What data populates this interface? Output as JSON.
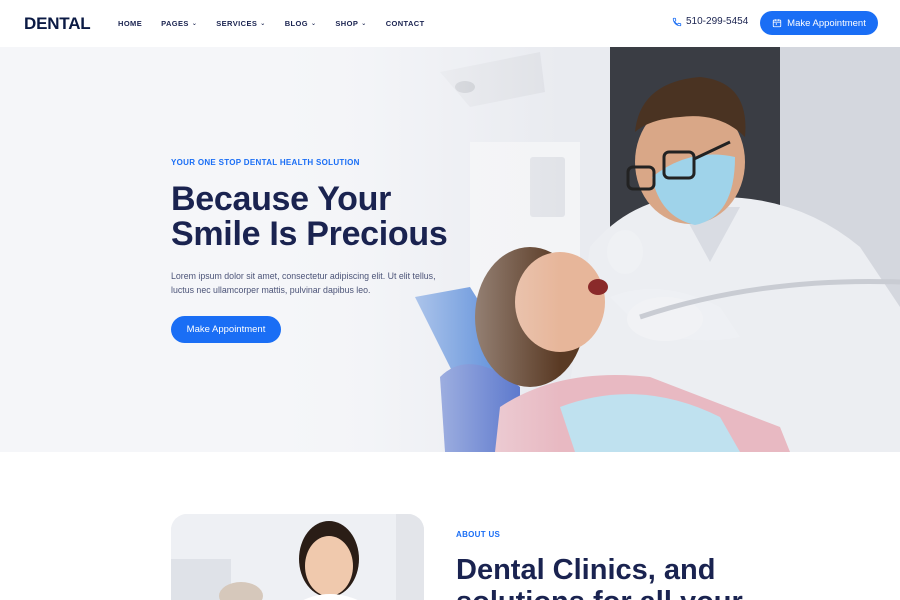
{
  "header": {
    "logo": "DENTAL",
    "nav": [
      {
        "label": "HOME",
        "dropdown": false
      },
      {
        "label": "PAGES",
        "dropdown": true
      },
      {
        "label": "SERVICES",
        "dropdown": true
      },
      {
        "label": "BLOG",
        "dropdown": true
      },
      {
        "label": "SHOP",
        "dropdown": true
      },
      {
        "label": "CONTACT",
        "dropdown": false
      }
    ],
    "phone": "510-299-5454",
    "phone_icon": "phone-icon",
    "cta_label": "Make Appointment",
    "cta_icon": "calendar-icon"
  },
  "hero": {
    "eyebrow": "YOUR ONE STOP DENTAL HEALTH SOLUTION",
    "headline_line1": "Because Your",
    "headline_line2": "Smile Is Precious",
    "lead": "Lorem ipsum dolor sit amet, consectetur adipiscing elit. Ut elit tellus, luctus nec ullamcorper mattis, pulvinar dapibus leo.",
    "cta_label": "Make Appointment"
  },
  "about": {
    "eyebrow": "ABOUT US",
    "title": "Dental Clinics, and solutions for all your"
  },
  "colors": {
    "accent": "#1a6ef5",
    "navy": "#1a2350",
    "hero_bg": "#f5f6f9"
  }
}
